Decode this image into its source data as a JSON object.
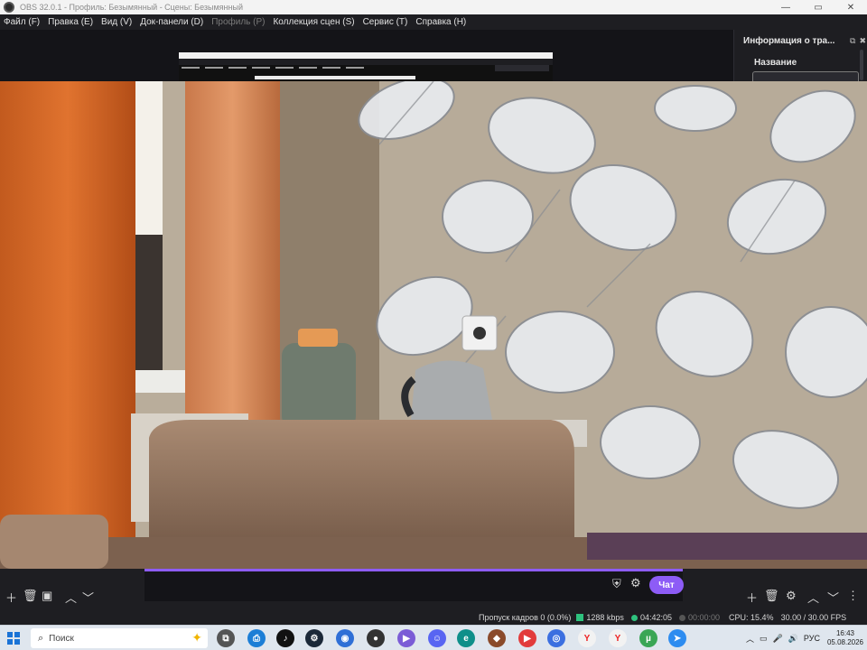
{
  "window": {
    "title": "OBS 32.0.1 - Профиль: Безымянный - Сцены: Безымянный",
    "minimize": "—",
    "maximize": "▭",
    "close": "✕"
  },
  "menu": {
    "items": [
      {
        "label": "Файл (F)",
        "disabled": false
      },
      {
        "label": "Правка (E)",
        "disabled": false
      },
      {
        "label": "Вид (V)",
        "disabled": false
      },
      {
        "label": "Док-панели (D)",
        "disabled": false
      },
      {
        "label": "Профиль (P)",
        "disabled": true
      },
      {
        "label": "Коллекция сцен (S)",
        "disabled": false
      },
      {
        "label": "Сервис (T)",
        "disabled": false
      },
      {
        "label": "Справка (H)",
        "disabled": false
      }
    ]
  },
  "dock_right": {
    "header_title": "Информация о тра...",
    "name_label": "Название"
  },
  "chat": {
    "button_label": "Чат"
  },
  "status": {
    "dropped_frames": "Пропуск кадров 0 (0.0%)",
    "bitrate": "1288 kbps",
    "live_time": "04:42:05",
    "rec_time": "00:00:00",
    "cpu": "CPU: 15.4%",
    "fps": "30.00 / 30.00 FPS"
  },
  "taskbar": {
    "search_placeholder": "Поиск",
    "language": "РУС",
    "time": "16:43",
    "date": "05.08.2026"
  },
  "colors": {
    "accent": "#8d5cf6",
    "bitrate_ok": "#2ec27e"
  }
}
